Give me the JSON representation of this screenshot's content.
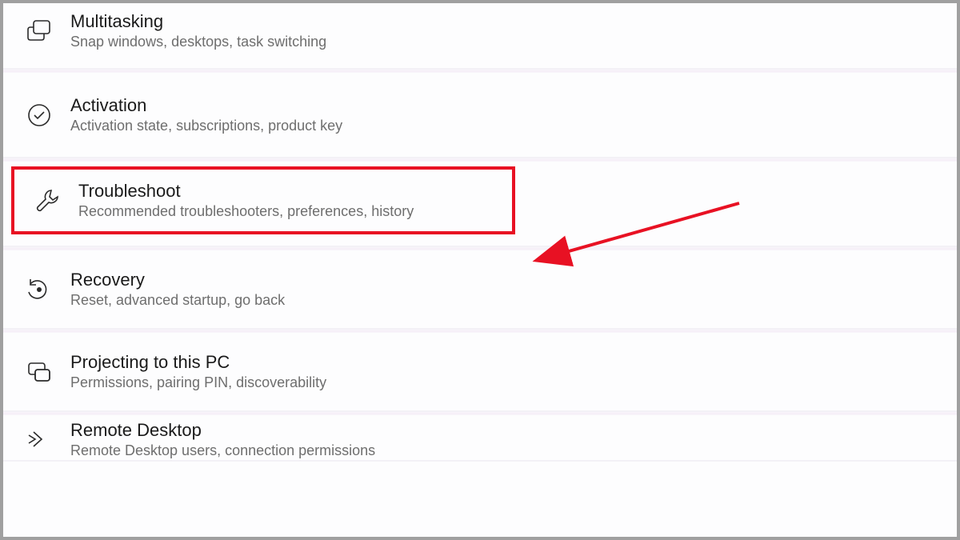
{
  "items": [
    {
      "title": "Multitasking",
      "sub": "Snap windows, desktops, task switching"
    },
    {
      "title": "Activation",
      "sub": "Activation state, subscriptions, product key"
    },
    {
      "title": "Troubleshoot",
      "sub": "Recommended troubleshooters, preferences, history"
    },
    {
      "title": "Recovery",
      "sub": "Reset, advanced startup, go back"
    },
    {
      "title": "Projecting to this PC",
      "sub": "Permissions, pairing PIN, discoverability"
    },
    {
      "title": "Remote Desktop",
      "sub": "Remote Desktop users, connection permissions"
    }
  ]
}
